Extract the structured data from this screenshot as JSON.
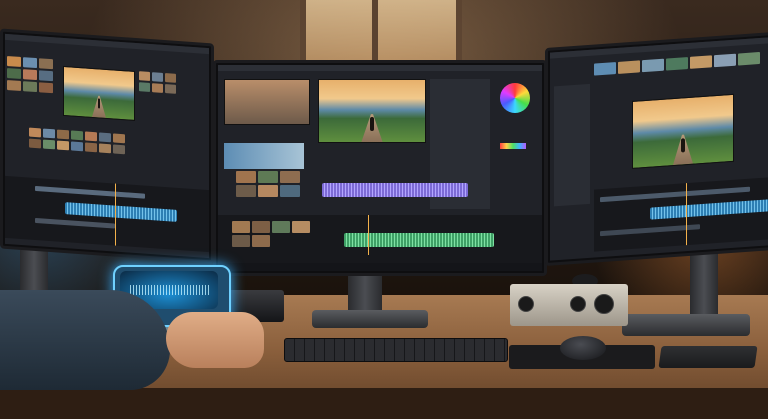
{
  "scene": {
    "description_tags": [
      "video-editing-workstation",
      "triple-monitor",
      "desk"
    ],
    "accent_colors": {
      "waveform_purple": "#7d6bd6",
      "waveform_green": "#3fa066",
      "waveform_blue": "#2e7fb3",
      "tablet_glow": "#3ab0ff"
    }
  },
  "monitors": [
    {
      "name": "left",
      "app": "video-editor"
    },
    {
      "name": "center",
      "app": "video-editor"
    },
    {
      "name": "right",
      "app": "video-editor"
    }
  ]
}
